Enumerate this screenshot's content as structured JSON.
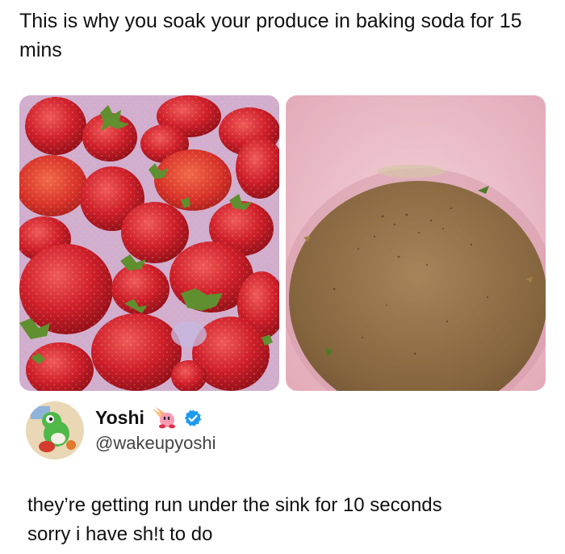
{
  "post": {
    "title": "This is why you soak your produce in baking soda for 15 mins"
  },
  "images": {
    "left_alt": "strawberries-soaking",
    "right_alt": "dirty-soak-water"
  },
  "tweet": {
    "display_name": "Yoshi",
    "handle": "@wakeupyoshi",
    "verified": true,
    "name_emoji": "kirby-emoji",
    "text_line1": "they’re getting run under the sink for 10 seconds",
    "text_line2": "sorry i have sh!t to do"
  },
  "colors": {
    "verified_blue": "#1d9bf0",
    "strawberry_red": "#c8202a",
    "bowl_pink": "#e9b8c4",
    "water_brown": "#8a6a45"
  }
}
